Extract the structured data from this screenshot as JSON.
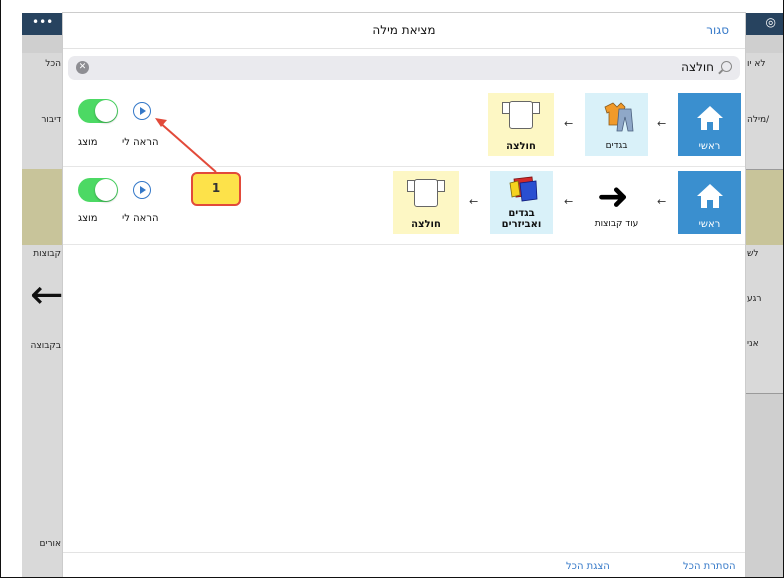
{
  "modal": {
    "title": "מציאת מילה",
    "close_label": "סגור"
  },
  "search": {
    "value": "חולצה"
  },
  "results": [
    {
      "path": [
        {
          "label": "ראשי",
          "icon": "home-icon",
          "color": "#3a8fcf"
        },
        {
          "label": "בגדים",
          "icon": "clothes-icon",
          "color": "#d9f1f9"
        },
        {
          "label": "חולצה",
          "icon": "shirt-icon",
          "color": "#fdf7c4"
        }
      ],
      "show_me_label": "הראה לי",
      "displayed_label": "מוצג",
      "displayed": true
    },
    {
      "path": [
        {
          "label": "ראשי",
          "icon": "home-icon",
          "color": "#3a8fcf"
        },
        {
          "label": "עוד קבוצות",
          "icon": "arrow-right-icon",
          "color": "#ffffff"
        },
        {
          "label": "בגדים ואביזרים",
          "icon": "clothes-accessories-icon",
          "color": "#d9f1f9"
        },
        {
          "label": "חולצה",
          "icon": "shirt-icon",
          "color": "#fdf7c4"
        }
      ],
      "show_me_label": "הראה לי",
      "displayed_label": "מוצג",
      "displayed": true
    }
  ],
  "annotation": {
    "number": "1"
  },
  "footer": {
    "show_all_label": "הצגת הכל",
    "hide_all_label": "הסתרת הכל"
  },
  "background": {
    "left_labels": [
      "הכל",
      "דיבור",
      "קבוצות",
      "בקבוצה",
      "אורים"
    ],
    "right_labels": [
      "לא יו",
      "מילה/",
      "לש",
      "רגע",
      "אני"
    ]
  },
  "colors": {
    "accent": "#3478c8",
    "toggle_on": "#4cd964",
    "callout_fill": "#fde24a",
    "callout_border": "#e24a3a"
  }
}
